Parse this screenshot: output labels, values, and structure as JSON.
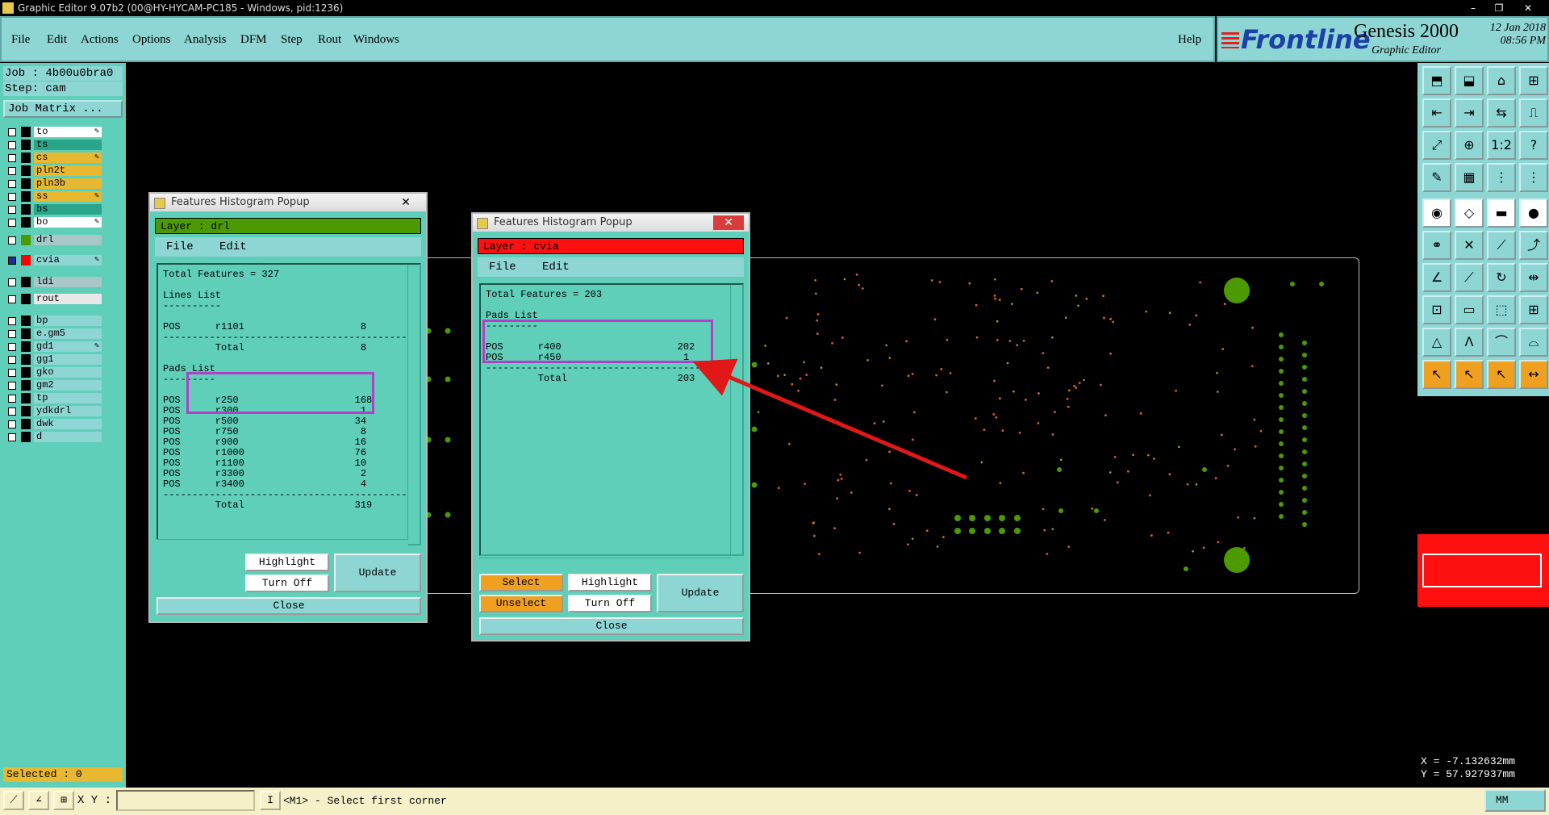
{
  "window": {
    "title": "Graphic Editor 9.07b2 (00@HY-HYCAM-PC185 - Windows, pid:1236)",
    "controls": [
      "–",
      "❐",
      "✕"
    ]
  },
  "menu": {
    "items": [
      "File",
      "Edit",
      "Actions",
      "Options",
      "Analysis",
      "DFM",
      "Step",
      "Rout",
      "Windows"
    ],
    "help": "Help"
  },
  "brand": {
    "logo": "Frontline",
    "product": "Genesis 2000",
    "subtitle": "Graphic Editor",
    "date": "12 Jan 2018",
    "time": "08:56 PM"
  },
  "job": {
    "job_line": "Job : 4b00u0bra0",
    "step_line": "Step: cam",
    "matrix_button": "Job Matrix ..."
  },
  "layers": [
    {
      "name": "to",
      "color": "#ffffff",
      "swatch": "#000000",
      "edit": true,
      "active": false
    },
    {
      "name": "ts",
      "color": "#2aa58a",
      "swatch": "#000000",
      "edit": false,
      "active": false
    },
    {
      "name": "cs",
      "color": "#e8b830",
      "swatch": "#000000",
      "edit": true,
      "active": false
    },
    {
      "name": "pln2t",
      "color": "#e8b830",
      "swatch": "#000000",
      "edit": false,
      "active": false
    },
    {
      "name": "pln3b",
      "color": "#e8b830",
      "swatch": "#000000",
      "edit": false,
      "active": false
    },
    {
      "name": "ss",
      "color": "#e8b830",
      "swatch": "#000000",
      "edit": true,
      "active": false
    },
    {
      "name": "bs",
      "color": "#2aa58a",
      "swatch": "#000000",
      "edit": false,
      "active": false
    },
    {
      "name": "bo",
      "color": "#ffffff",
      "swatch": "#000000",
      "edit": true,
      "active": false
    },
    {
      "name": "drl",
      "color": "#a8c8c8",
      "swatch": "#4c9a00",
      "edit": false,
      "active": false
    },
    {
      "name": "cvia",
      "color": "#8ed6d4",
      "swatch": "#ff0000",
      "edit": true,
      "active": true
    },
    {
      "name": "ldi",
      "color": "#a8c8c8",
      "swatch": "#000000",
      "edit": false,
      "active": false
    },
    {
      "name": "rout",
      "color": "#e8e8e8",
      "swatch": "#000000",
      "edit": false,
      "active": false
    },
    {
      "name": "bp",
      "color": "#8ed6d4",
      "swatch": "#000000",
      "edit": false,
      "active": false
    },
    {
      "name": "e.gm5",
      "color": "#8ed6d4",
      "swatch": "#000000",
      "edit": false,
      "active": false
    },
    {
      "name": "gd1",
      "color": "#8ed6d4",
      "swatch": "#000000",
      "edit": true,
      "active": false
    },
    {
      "name": "gg1",
      "color": "#8ed6d4",
      "swatch": "#000000",
      "edit": false,
      "active": false
    },
    {
      "name": "gko",
      "color": "#8ed6d4",
      "swatch": "#000000",
      "edit": false,
      "active": false
    },
    {
      "name": "gm2",
      "color": "#8ed6d4",
      "swatch": "#000000",
      "edit": false,
      "active": false
    },
    {
      "name": "tp",
      "color": "#8ed6d4",
      "swatch": "#000000",
      "edit": false,
      "active": false
    },
    {
      "name": "ydkdrl",
      "color": "#8ed6d4",
      "swatch": "#000000",
      "edit": false,
      "active": false
    },
    {
      "name": "dwk",
      "color": "#8ed6d4",
      "swatch": "#000000",
      "edit": false,
      "active": false
    },
    {
      "name": "d",
      "color": "#8ed6d4",
      "swatch": "#000000",
      "edit": false,
      "active": false
    }
  ],
  "selected": "Selected : 0",
  "popup_drl": {
    "title": "Features Histogram Popup",
    "close": "✕",
    "layer": "Layer :  drl",
    "layer_color": "#4c9a00",
    "menu": [
      "File",
      "Edit"
    ],
    "lines": [
      "Total Features = 327",
      "",
      "Lines List",
      "----------",
      "",
      "POS      r1101                    8",
      "------------------------------------------",
      "         Total                    8",
      "",
      "Pads List",
      "---------",
      "",
      "POS      r250                    168",
      "POS      r300                     1",
      "POS      r500                    34",
      "POS      r750                     8",
      "POS      r900                    16",
      "POS      r1000                   76",
      "POS      r1100                   10",
      "POS      r3300                    2",
      "POS      r3400                    4",
      "------------------------------------------",
      "         Total                   319"
    ],
    "buttons": {
      "highlight": "Highlight",
      "turn_off": "Turn Off",
      "update": "Update",
      "close": "Close"
    }
  },
  "popup_cvia": {
    "title": "Features Histogram Popup",
    "close": "✕",
    "layer": "Layer :  cvia",
    "layer_color": "#ff1010",
    "menu": [
      "File",
      "Edit"
    ],
    "lines": [
      "Total Features = 203",
      "",
      "Pads List",
      "---------",
      "",
      "POS      r400                    202",
      "POS      r450                     1",
      "------------------------------------------",
      "         Total                   203"
    ],
    "buttons": {
      "select": "Select",
      "unselect": "Unselect",
      "highlight": "Highlight",
      "turn_off": "Turn Off",
      "update": "Update",
      "close": "Close"
    }
  },
  "coords": {
    "x": "X = -7.132632mm",
    "y": "Y = 57.927937mm"
  },
  "bottom": {
    "xy_label": "X Y :",
    "xy_value": "",
    "status": "<M1> - Select first corner",
    "units": "MM"
  },
  "toolbox_icons": [
    "window-full-icon",
    "window-save-icon",
    "home-icon",
    "panel-split-icon",
    "pan-left-icon",
    "pan-right-icon",
    "swap-icon",
    "snap-icon",
    "zoom-fit-icon",
    "zoom-center-icon",
    "scale-1-2-icon",
    "help-question-icon",
    "pen-tool-icon",
    "grid-icon",
    "measure-red-icon",
    "measure-multi-icon",
    "record-icon",
    "edit-shape-icon",
    "ruler-icon",
    "dot-icon",
    "connect-icon",
    "cross-delete-icon",
    "line-point-icon",
    "move-point-icon",
    "draw-line-icon",
    "draw-diag-icon",
    "rotate-icon",
    "mirror-icon",
    "add-pad-icon",
    "minus-line-icon",
    "resize-icon",
    "group-icon",
    "triangle-icon",
    "triangle-a-icon",
    "arch-a-icon",
    "arch-b-icon",
    "cursor-icon",
    "cursor-select-icon",
    "cursor-pick-icon",
    "cursor-move-icon"
  ]
}
